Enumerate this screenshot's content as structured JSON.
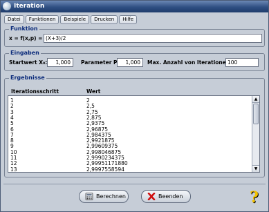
{
  "window": {
    "title": "Iteration"
  },
  "menu": [
    "Datei",
    "Funktionen",
    "Beispiele",
    "Drucken",
    "Hilfe"
  ],
  "funktion": {
    "legend": "Funktion",
    "label": "x = f(x,p) =",
    "value": "(X+3)/2"
  },
  "eingaben": {
    "legend": "Eingaben",
    "start_label": "Startwert X₀:",
    "start_value": "1,000",
    "param_label": "Parameter P:",
    "param_value": "1,000",
    "max_label": "Max. Anzahl von Iterationen:",
    "max_value": "100"
  },
  "ergebnisse": {
    "legend": "Ergebnisse",
    "col1": "Iterationsschritt",
    "col2": "Wert",
    "rows": [
      [
        "1",
        "2"
      ],
      [
        "2",
        "2,5"
      ],
      [
        "3",
        "2,75"
      ],
      [
        "4",
        "2,875"
      ],
      [
        "5",
        "2,9375"
      ],
      [
        "6",
        "2,96875"
      ],
      [
        "7",
        "2,984375"
      ],
      [
        "8",
        "2,9921875"
      ],
      [
        "9",
        "2,99609375"
      ],
      [
        "10",
        "2,998046875"
      ],
      [
        "11",
        "2,9990234375"
      ],
      [
        "12",
        "2,99951171880"
      ],
      [
        "13",
        "2,9997558594"
      ]
    ]
  },
  "buttons": {
    "berechnen": "Berechnen",
    "beenden": "Beenden"
  },
  "colors": {
    "accent": "#2f4f82",
    "legend": "#0a2a7a",
    "close_x": "#d01010"
  }
}
